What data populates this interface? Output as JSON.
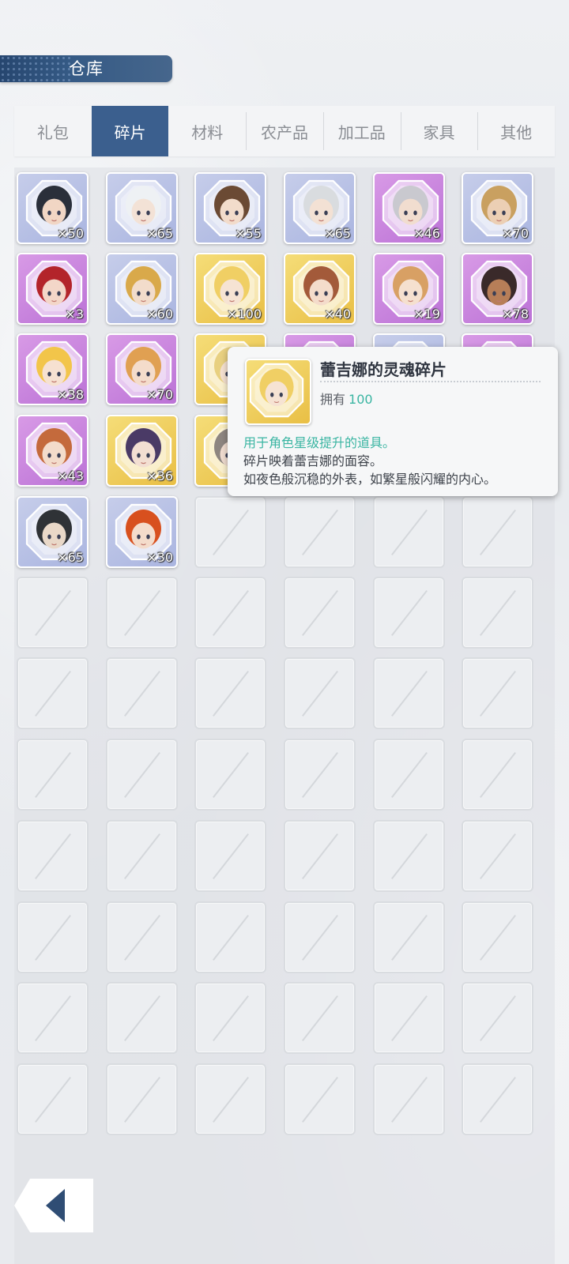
{
  "header": {
    "title": "仓库"
  },
  "tabs": [
    {
      "label": "礼包",
      "active": false
    },
    {
      "label": "碎片",
      "active": true
    },
    {
      "label": "材料",
      "active": false
    },
    {
      "label": "农产品",
      "active": false
    },
    {
      "label": "加工品",
      "active": false
    },
    {
      "label": "家具",
      "active": false
    },
    {
      "label": "其他",
      "active": false
    }
  ],
  "items": [
    {
      "count": "×50",
      "rarity": "blue",
      "hair": "#2a2f3a",
      "skin": "#f1d6c4"
    },
    {
      "count": "×65",
      "rarity": "blue",
      "hair": "#eef1f4",
      "skin": "#f3e2d6"
    },
    {
      "count": "×55",
      "rarity": "blue",
      "hair": "#6b4a34",
      "skin": "#f2dccb"
    },
    {
      "count": "×65",
      "rarity": "blue",
      "hair": "#d9dcdf",
      "skin": "#f3e1d4"
    },
    {
      "count": "×46",
      "rarity": "purple",
      "hair": "#c9c9cf",
      "skin": "#f1ddcf"
    },
    {
      "count": "×70",
      "rarity": "blue",
      "hair": "#c9a060",
      "skin": "#eccfb4"
    },
    {
      "count": "×3",
      "rarity": "purple",
      "hair": "#b3242a",
      "skin": "#f3d6c8"
    },
    {
      "count": "×60",
      "rarity": "blue",
      "hair": "#d9a94a",
      "skin": "#f2dccb"
    },
    {
      "count": "×100",
      "rarity": "gold",
      "hair": "#f0cf64",
      "skin": "#f6e3d3"
    },
    {
      "count": "×40",
      "rarity": "gold",
      "hair": "#a35a3a",
      "skin": "#f4dccb"
    },
    {
      "count": "×19",
      "rarity": "purple",
      "hair": "#d8a064",
      "skin": "#f5e0cf"
    },
    {
      "count": "×78",
      "rarity": "purple",
      "hair": "#3a2a2a",
      "skin": "#b77e58"
    },
    {
      "count": "×38",
      "rarity": "purple",
      "hair": "#f2c54a",
      "skin": "#f6e1d1"
    },
    {
      "count": "×70",
      "rarity": "purple",
      "hair": "#e0a052",
      "skin": "#f4dccb"
    },
    {
      "count": "",
      "rarity": "gold",
      "hair": "#e8d080",
      "skin": "#f4e0d0"
    },
    {
      "count": "",
      "rarity": "purple",
      "hair": "#b0b0c0",
      "skin": "#f2dccb"
    },
    {
      "count": "",
      "rarity": "blue",
      "hair": "#b0b0c0",
      "skin": "#f2dccb"
    },
    {
      "count": "",
      "rarity": "purple",
      "hair": "#b0b0c0",
      "skin": "#f2dccb"
    },
    {
      "count": "×43",
      "rarity": "purple",
      "hair": "#c46a3c",
      "skin": "#f3dccb"
    },
    {
      "count": "×36",
      "rarity": "gold",
      "hair": "#4a3a66",
      "skin": "#f3dfd2"
    },
    {
      "count": "",
      "rarity": "gold",
      "hair": "#8d8580",
      "skin": "#f0dcd0"
    },
    {
      "count": "",
      "rarity": "blue",
      "hair": "#b0b0c0",
      "skin": "#f2dccb"
    },
    {
      "count": "",
      "rarity": "blue",
      "hair": "#b0b0c0",
      "skin": "#f2dccb"
    },
    {
      "count": "",
      "rarity": "blue",
      "hair": "#b0b0c0",
      "skin": "#f2dccb"
    },
    {
      "count": "×65",
      "rarity": "blue",
      "hair": "#2f3236",
      "skin": "#e9d8c8"
    },
    {
      "count": "×30",
      "rarity": "blue",
      "hair": "#d8501e",
      "skin": "#f4dccb"
    }
  ],
  "tooltip": {
    "name": "蕾吉娜的灵魂碎片",
    "own_label": "拥有",
    "own_value": "100",
    "use": "用于角色星级提升的道具。",
    "desc1": "碎片映着蕾吉娜的面容。",
    "desc2": "如夜色般沉稳的外表，如繁星般闪耀的内心。",
    "hair": "#f0cf64",
    "skin": "#f6e3d3"
  },
  "back_button": {
    "icon": "back-arrow-icon"
  }
}
